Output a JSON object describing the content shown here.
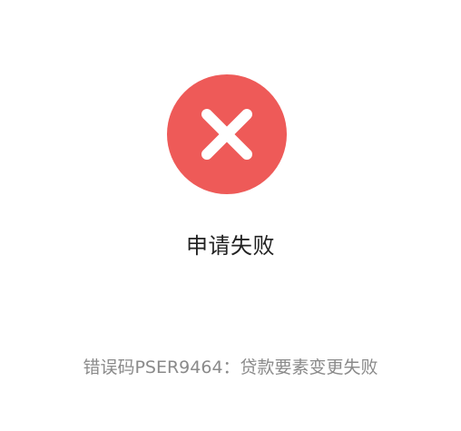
{
  "result": {
    "icon": "close-icon",
    "icon_color": "#EE5A58",
    "title": "申请失败",
    "error_message": "错误码PSER9464：贷款要素变更失败"
  }
}
